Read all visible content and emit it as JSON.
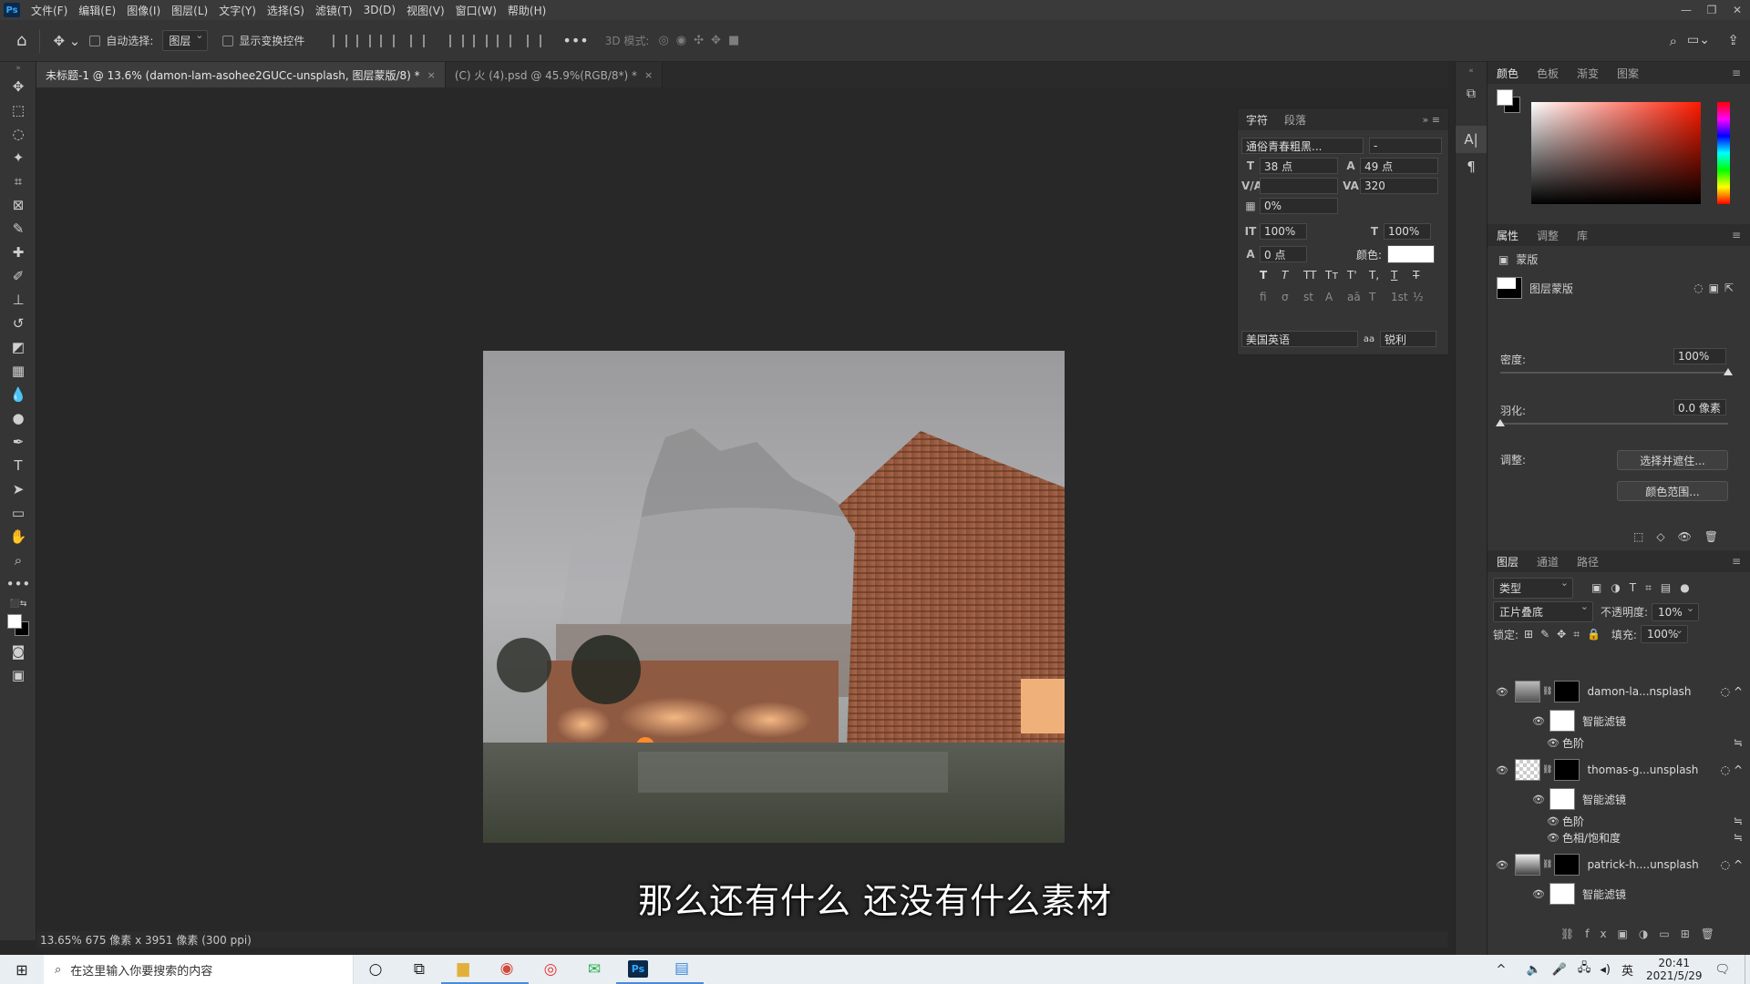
{
  "menubar": {
    "app_icon": "Ps",
    "items": [
      "文件(F)",
      "编辑(E)",
      "图像(I)",
      "图层(L)",
      "文字(Y)",
      "选择(S)",
      "滤镜(T)",
      "3D(D)",
      "视图(V)",
      "窗口(W)",
      "帮助(H)"
    ]
  },
  "options": {
    "auto_select_label": "自动选择:",
    "auto_select_target": "图层",
    "show_transform_label": "显示变换控件",
    "mode_3d_label": "3D 模式:"
  },
  "tabs": [
    {
      "label": "未标题-1 @ 13.6% (damon-lam-asohee2GUCc-unsplash, 图层蒙版/8) *",
      "close": "×"
    },
    {
      "label": "(C) 火 (4).psd @ 45.9%(RGB/8*) *",
      "close": "×"
    }
  ],
  "status": {
    "text": "13.65%  675 像素 x 3951 像素 (300 ppi)"
  },
  "subtitle": "那么还有什么 还没有什么素材",
  "character_panel": {
    "tabs": [
      "字符",
      "段落"
    ],
    "font_family": "通俗青春粗黑...",
    "font_style": "-",
    "font_size": "38 点",
    "leading": "49 点",
    "kerning": "",
    "tracking": "320",
    "tsume": "0%",
    "vertical_scale": "100%",
    "horizontal_scale": "100%",
    "baseline_shift": "0 点",
    "color_label": "颜色:",
    "color_value": "#ffffff",
    "language": "美国英语",
    "antialias_label": "aa",
    "antialias": "锐利",
    "style_buttons": [
      "T",
      "T",
      "TT",
      "Tт",
      "T'",
      "T,",
      "T",
      "T"
    ],
    "opentype_buttons": [
      "fi",
      "σ",
      "st",
      "A",
      "aā",
      "T",
      "1st",
      "½"
    ]
  },
  "color_panel": {
    "tabs": [
      "颜色",
      "色板",
      "渐变",
      "图案"
    ],
    "hue_color": "#ff1a00"
  },
  "properties_panel": {
    "tabs": [
      "属性",
      "调整",
      "库"
    ],
    "mask_title": "蒙版",
    "layer_mask_label": "图层蒙版",
    "density_label": "密度:",
    "density_value": "100%",
    "density_level": 1.0,
    "feather_label": "羽化:",
    "feather_value": "0.0 像素",
    "feather_level": 0.0,
    "adjust_label": "调整:",
    "select_and_mask_button": "选择并遮住...",
    "color_range_button": "颜色范围..."
  },
  "layers_panel": {
    "tabs": [
      "图层",
      "通道",
      "路径"
    ],
    "filter_kind": "类型",
    "blend_mode": "正片叠底",
    "opacity_label": "不透明度:",
    "opacity_value": "10%",
    "lock_label": "锁定:",
    "fill_label": "填充:",
    "fill_value": "100%",
    "layers": [
      {
        "name": "damon-la...nsplash",
        "kind": "smart"
      },
      {
        "name": "智能滤镜",
        "kind": "filter-mask"
      },
      {
        "name": "色阶",
        "kind": "filter"
      },
      {
        "name": "thomas-g...unsplash",
        "kind": "smart"
      },
      {
        "name": "智能滤镜",
        "kind": "filter-mask"
      },
      {
        "name": "色阶",
        "kind": "filter"
      },
      {
        "name": "色相/饱和度",
        "kind": "filter"
      },
      {
        "name": "patrick-h....unsplash",
        "kind": "smart"
      },
      {
        "name": "智能滤镜",
        "kind": "filter-mask"
      }
    ]
  },
  "taskbar": {
    "search_placeholder": "在这里输入你要搜索的内容",
    "ime": "英",
    "time": "20:41",
    "date": "2021/5/29"
  }
}
